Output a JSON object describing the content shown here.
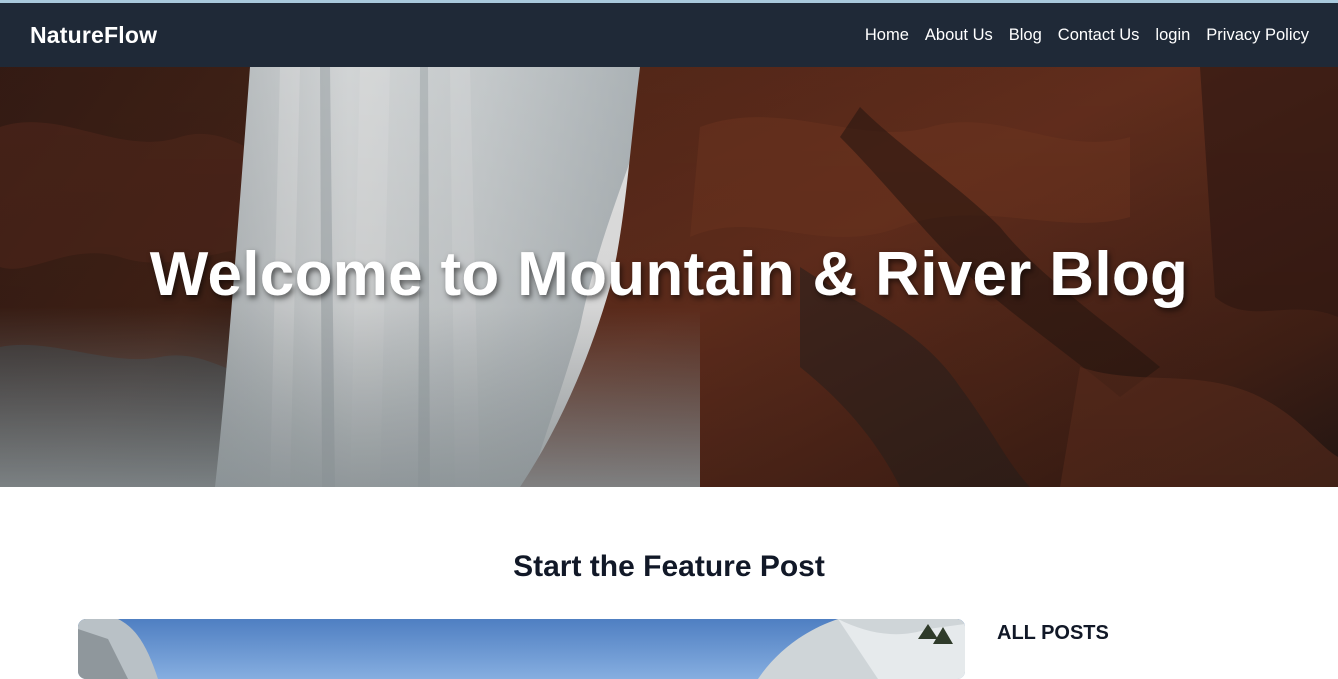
{
  "brand": {
    "name": "NatureFlow"
  },
  "nav": {
    "items": [
      {
        "label": "Home"
      },
      {
        "label": "About Us"
      },
      {
        "label": "Blog"
      },
      {
        "label": "Contact Us"
      },
      {
        "label": "login"
      },
      {
        "label": "Privacy Policy"
      }
    ]
  },
  "hero": {
    "title": "Welcome to Mountain & River Blog",
    "image": "waterfall-red-cliffs-photo"
  },
  "feature": {
    "heading": "Start the Feature Post",
    "image": "mountain-valley-photo"
  },
  "sidebar": {
    "title": "ALL POSTS"
  },
  "colors": {
    "navbar_bg": "#1f2937",
    "text_dark": "#111827",
    "white": "#ffffff"
  }
}
